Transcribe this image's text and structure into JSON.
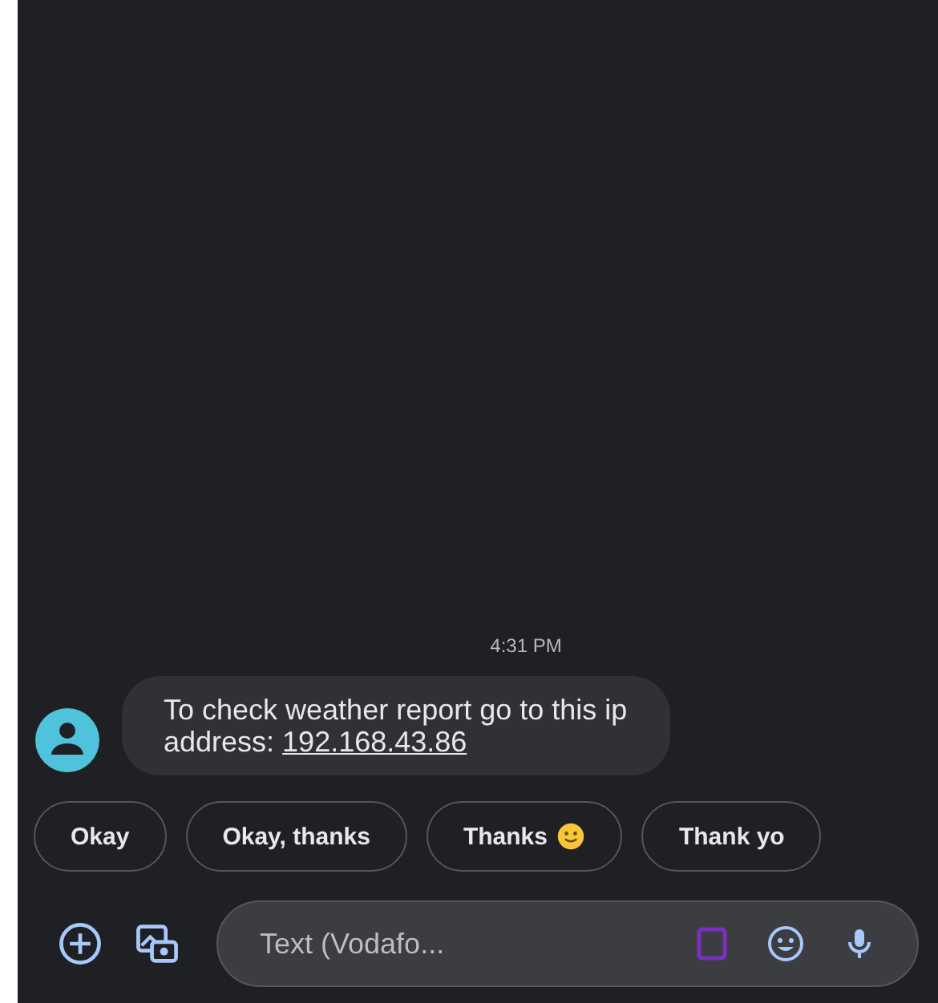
{
  "conversation": {
    "timestamp": "4:31 PM",
    "messages": [
      {
        "text": "To check weather report go to this ip address: ",
        "link": "192.168.43.86"
      }
    ]
  },
  "smart_replies": [
    {
      "label": "Okay",
      "emoji": false
    },
    {
      "label": "Okay, thanks",
      "emoji": false
    },
    {
      "label": "Thanks",
      "emoji": true
    },
    {
      "label": "Thank yo",
      "emoji": false
    }
  ],
  "compose": {
    "placeholder": "Text (Vodafo..."
  }
}
